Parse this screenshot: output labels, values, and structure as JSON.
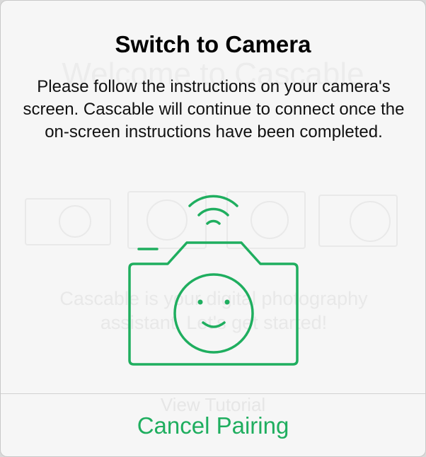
{
  "background": {
    "title": "Welcome to Cascable",
    "description": "Cascable is your digital photography assistant. Let's get started!",
    "link_label": "View Tutorial"
  },
  "alert": {
    "title": "Switch to Camera",
    "message": "Please follow the instructions on your camera's screen. Cascable will continue to connect once the on-screen instructions have been completed.",
    "illustration_icon": "camera-smiley-wifi-icon",
    "cancel_label": "Cancel Pairing"
  },
  "colors": {
    "accent": "#1fae5f",
    "alert_background": "#f6f6f6",
    "divider": "#d2d2d2"
  }
}
